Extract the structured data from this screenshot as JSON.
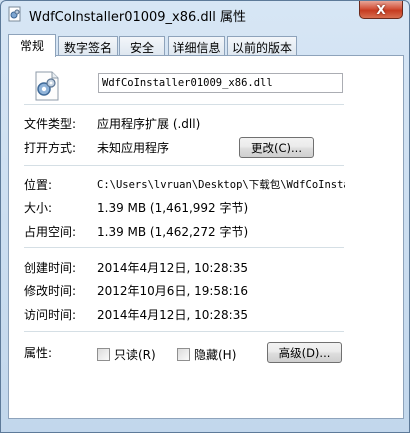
{
  "window": {
    "title": "WdfCoInstaller01009_x86.dll 属性",
    "close_glyph": "X"
  },
  "tabs": [
    {
      "label": "常规",
      "active": true
    },
    {
      "label": "数字签名",
      "active": false
    },
    {
      "label": "安全",
      "active": false
    },
    {
      "label": "详细信息",
      "active": false
    },
    {
      "label": "以前的版本",
      "active": false
    }
  ],
  "general": {
    "file_name": "WdfCoInstaller01009_x86.dll",
    "file_icon": "dll-file-gear-icon",
    "type_label": "文件类型:",
    "type_value": "应用程序扩展 (.dll)",
    "opens_with_label": "打开方式:",
    "opens_with_value": "未知应用程序",
    "change_button": "更改(C)...",
    "location_label": "位置:",
    "location_value": "C:\\Users\\lvruan\\Desktop\\下载包\\WdfCoInsta",
    "size_label": "大小:",
    "size_value": "1.39 MB (1,461,992 字节)",
    "size_on_disk_label": "占用空间:",
    "size_on_disk_value": "1.39 MB (1,462,272 字节)",
    "created_label": "创建时间:",
    "created_value": "2014年4月12日, 10:28:35",
    "modified_label": "修改时间:",
    "modified_value": "2012年10月6日, 19:58:16",
    "accessed_label": "访问时间:",
    "accessed_value": "2014年4月12日, 10:28:35",
    "attributes_label": "属性:",
    "readonly_label": "只读(R)",
    "readonly_checked": false,
    "hidden_label": "隐藏(H)",
    "hidden_checked": false,
    "advanced_button": "高级(D)..."
  },
  "colors": {
    "frame": "#c2d7ec",
    "close_button": "#c63b20",
    "panel": "#ffffff"
  }
}
